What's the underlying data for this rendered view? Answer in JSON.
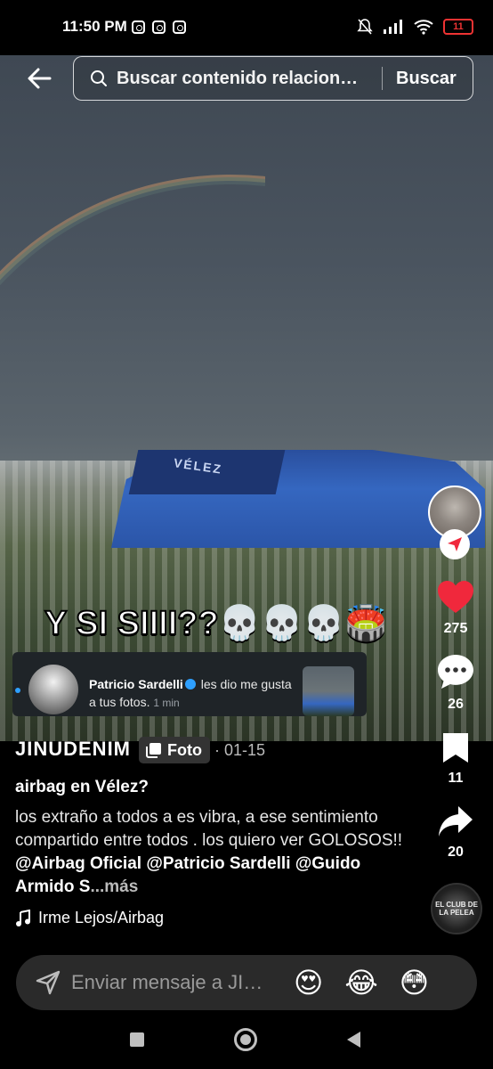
{
  "status_bar": {
    "time": "11:50 PM",
    "battery": "11"
  },
  "search": {
    "placeholder": "Buscar contenido relacionado",
    "button": "Buscar"
  },
  "overlay": {
    "caption": "Y SI SIIII??",
    "caption_emojis": "💀💀💀🏟️"
  },
  "stadium_sign": "VÉLEZ",
  "actions": {
    "likes": "275",
    "comments": "26",
    "saves": "11",
    "shares": "20"
  },
  "notification": {
    "name": "Patricio Sardelli",
    "message": "les dio me gusta a tus fotos.",
    "time": "1 min"
  },
  "post": {
    "username": "JINUDENIM",
    "type_label": "Foto",
    "date": "· 01-15",
    "title": "airbag en Vélez?",
    "description": "los extraño a todos  a es vibra, a ese sentimiento compartido entre todos . los quiero ver GOLOSOS!! ",
    "mentions": "@Airbag Oficial @Patricio Sardelli @Guido Armido S",
    "more": "...más",
    "music": "Irme Lejos/Airbag",
    "music_disc_text": "EL CLUB DE LA PELEA"
  },
  "message_bar": {
    "placeholder": "Enviar mensaje a JINUDENIM",
    "emojis": [
      "😍",
      "😂",
      "😳"
    ]
  },
  "colors": {
    "like_red": "#f0283c",
    "verified_blue": "#2ea0ff",
    "follow_red": "#f0283c"
  }
}
